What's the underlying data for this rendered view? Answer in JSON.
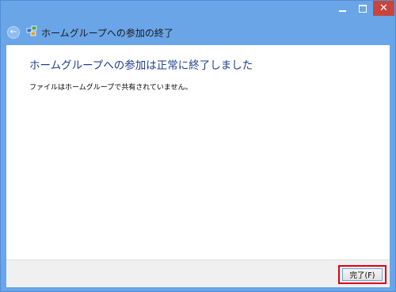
{
  "window": {
    "title": "ホームグループへの参加の終了",
    "controls": {
      "minimize_icon": "minimize-icon",
      "maximize_icon": "maximize-icon",
      "close_icon": "close-icon",
      "close_glyph": "✕"
    }
  },
  "nav": {
    "back_glyph": "←"
  },
  "main": {
    "heading": "ホームグループへの参加は正常に終了しました",
    "message": "ファイルはホームグループで共有されていません。"
  },
  "footer": {
    "finish_label": "完了(F)"
  },
  "colors": {
    "frame": "#6aa5e8",
    "heading": "#1e3d8f",
    "close": "#c7453c",
    "highlight": "#e00012"
  }
}
